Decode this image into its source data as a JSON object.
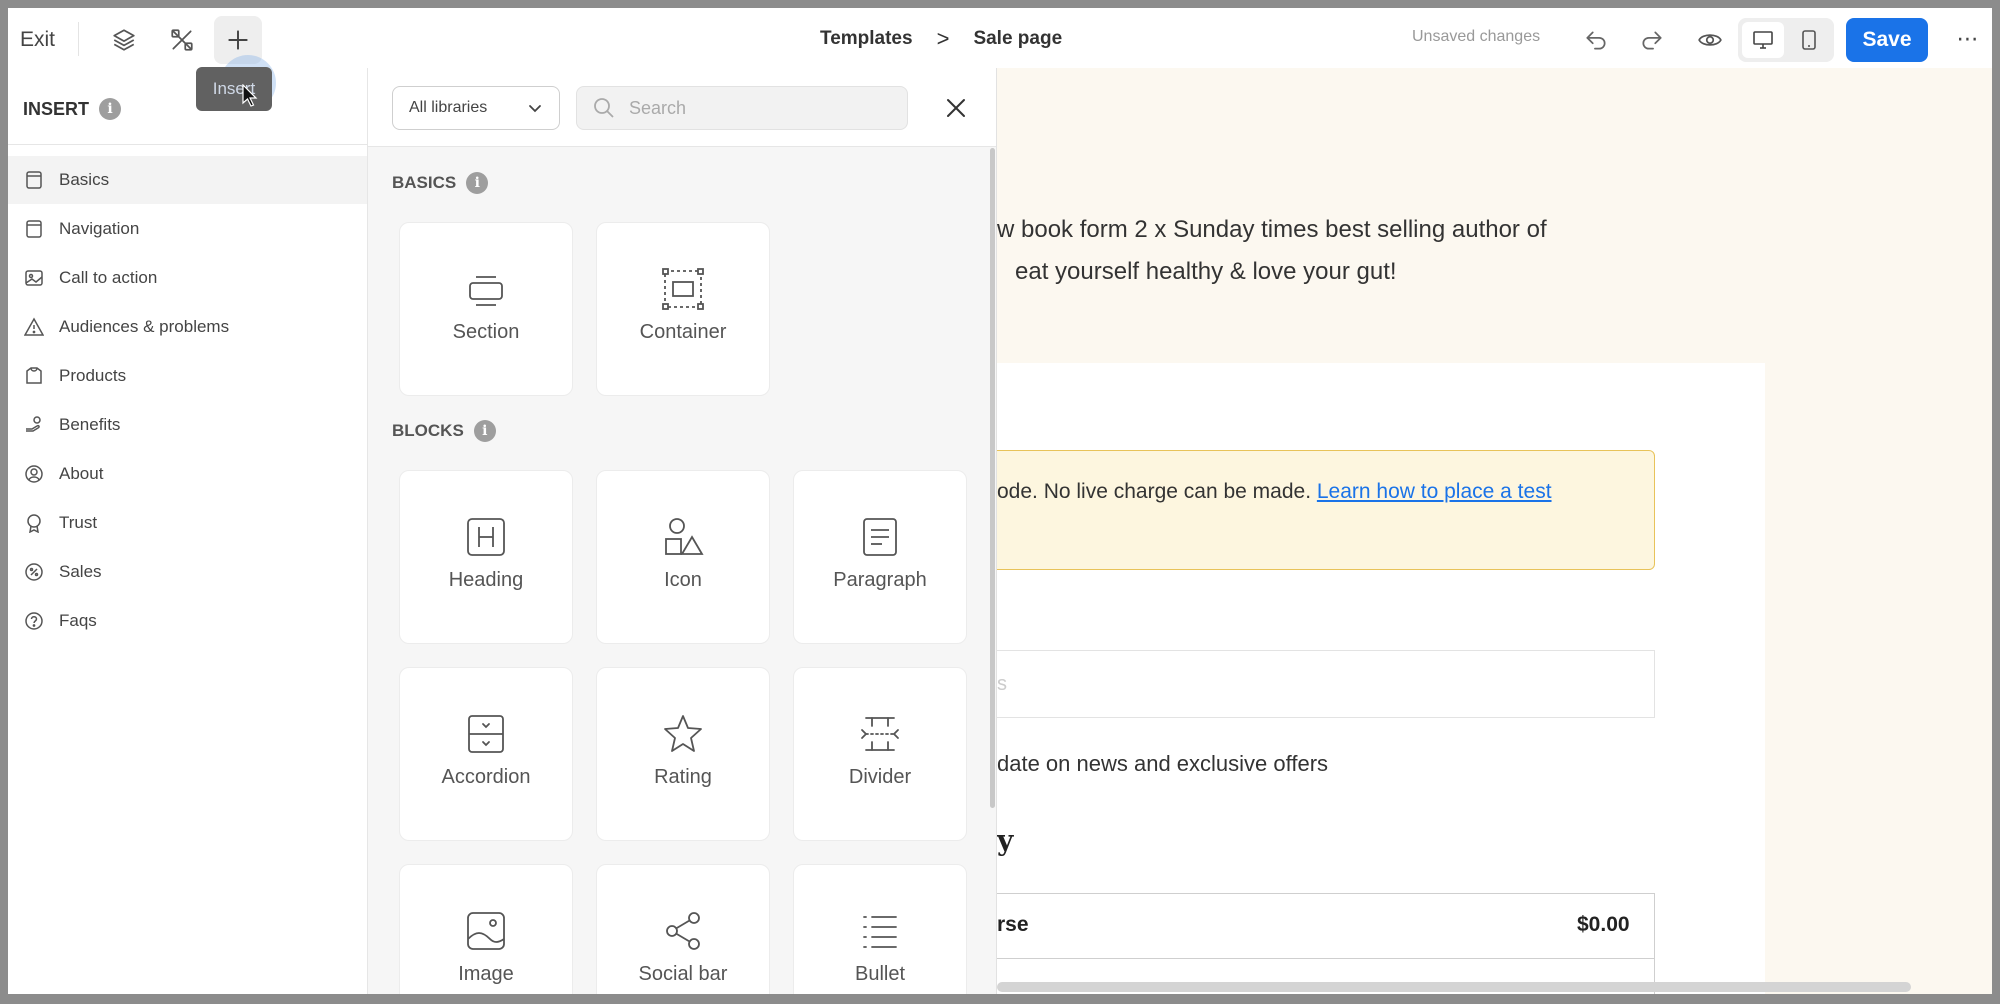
{
  "topbar": {
    "exit_label": "Exit",
    "breadcrumb": {
      "parent": "Templates",
      "separator": ">",
      "current": "Sale page"
    },
    "status": "Unsaved changes",
    "save_label": "Save",
    "more_label": "⋯",
    "tooltip": "Insert"
  },
  "icons": {
    "layers": "layers-icon",
    "tools": "tools-icon",
    "insert": "plus-icon",
    "undo": "undo-icon",
    "redo": "redo-icon",
    "preview": "eye-icon",
    "desktop": "desktop-icon",
    "mobile": "mobile-icon"
  },
  "sidebar": {
    "title": "INSERT",
    "items": [
      {
        "label": "Basics",
        "icon": "page-icon",
        "active": true
      },
      {
        "label": "Navigation",
        "icon": "page-icon"
      },
      {
        "label": "Call to action",
        "icon": "image-icon"
      },
      {
        "label": "Audiences & problems",
        "icon": "warning-icon"
      },
      {
        "label": "Products",
        "icon": "products-icon"
      },
      {
        "label": "Benefits",
        "icon": "benefits-icon"
      },
      {
        "label": "About",
        "icon": "user-icon"
      },
      {
        "label": "Trust",
        "icon": "award-icon"
      },
      {
        "label": "Sales",
        "icon": "sales-icon"
      },
      {
        "label": "Faqs",
        "icon": "question-icon"
      }
    ]
  },
  "library": {
    "select_value": "All libraries",
    "search_placeholder": "Search",
    "basics_title": "BASICS",
    "blocks_title": "BLOCKS",
    "basics": [
      {
        "label": "Section",
        "icon": "section-icon"
      },
      {
        "label": "Container",
        "icon": "container-icon"
      }
    ],
    "blocks": [
      {
        "label": "Heading",
        "icon": "heading-icon"
      },
      {
        "label": "Icon",
        "icon": "shapes-icon"
      },
      {
        "label": "Paragraph",
        "icon": "paragraph-icon"
      },
      {
        "label": "Accordion",
        "icon": "accordion-icon"
      },
      {
        "label": "Rating",
        "icon": "star-icon"
      },
      {
        "label": "Divider",
        "icon": "divider-icon"
      },
      {
        "label": "Image",
        "icon": "image-icon"
      },
      {
        "label": "Social bar",
        "icon": "share-icon"
      },
      {
        "label": "Bullet",
        "icon": "list-icon"
      }
    ]
  },
  "canvas": {
    "intro_line1": "w book form 2 x Sunday times best selling author of",
    "intro_line2": "eat yourself healthy & love your gut!",
    "alert_text": "ode. No live charge can be made. ",
    "alert_link": "Learn how to place a test",
    "input_hint": "s",
    "news_text": "date on news and exclusive offers",
    "heading_fragment": "y",
    "row_left": "rse",
    "row_right": "$0.00"
  },
  "colors": {
    "accent": "#1a73e8",
    "alert_bg": "#fdf6df",
    "alert_border": "#e8c35a"
  }
}
